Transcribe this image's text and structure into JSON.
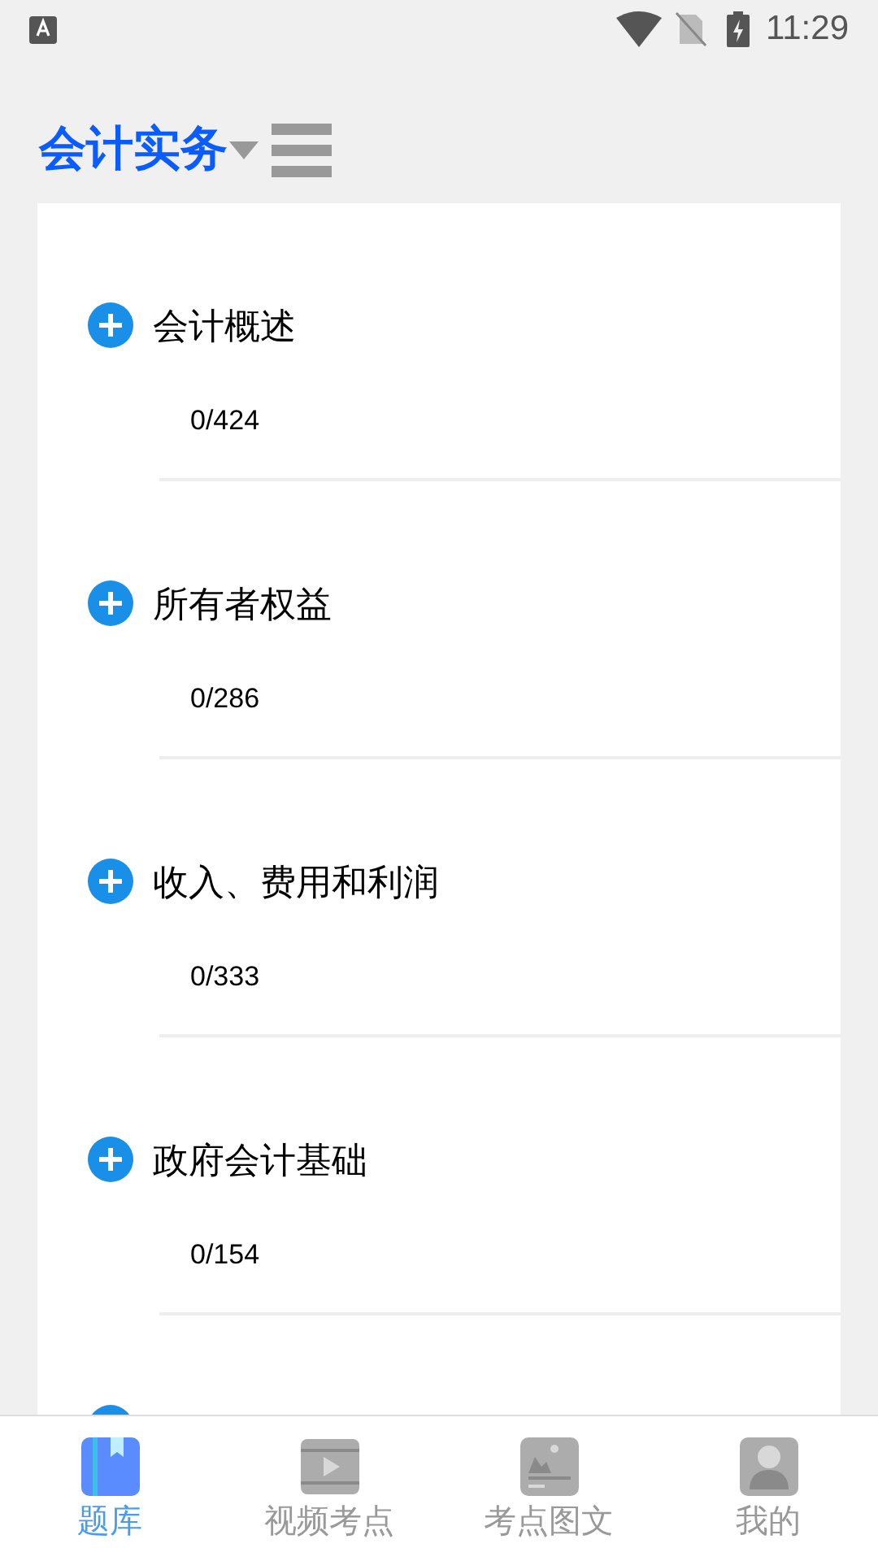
{
  "status_bar": {
    "time": "11:29"
  },
  "header": {
    "title": "会计实务"
  },
  "chapters": [
    {
      "title": "会计概述",
      "progress": "0/424"
    },
    {
      "title": "所有者权益",
      "progress": "0/286"
    },
    {
      "title": "收入、费用和利润",
      "progress": "0/333"
    },
    {
      "title": "政府会计基础",
      "progress": "0/154"
    }
  ],
  "bottom_nav": [
    {
      "label": "题库",
      "kind": "book",
      "selected": true
    },
    {
      "label": "视频考点",
      "kind": "video",
      "selected": false
    },
    {
      "label": "考点图文",
      "kind": "image",
      "selected": false
    },
    {
      "label": "我的",
      "kind": "profile",
      "selected": false
    }
  ]
}
